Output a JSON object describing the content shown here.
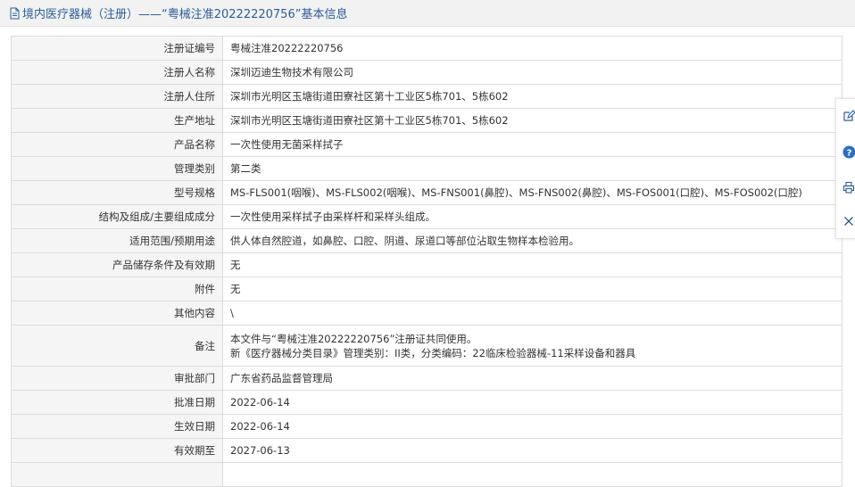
{
  "header": {
    "title": "境内医疗器械（注册）——“粤械注准20222220756”基本信息",
    "icon": "document-icon"
  },
  "rows": [
    {
      "label": "注册证编号",
      "value": [
        "粤械注准20222220756"
      ]
    },
    {
      "label": "注册人名称",
      "value": [
        "深圳迈迪生物技术有限公司"
      ]
    },
    {
      "label": "注册人住所",
      "value": [
        "深圳市光明区玉塘街道田寮社区第十工业区5栋701、5栋602"
      ]
    },
    {
      "label": "生产地址",
      "value": [
        "深圳市光明区玉塘街道田寮社区第十工业区5栋701、5栋602"
      ]
    },
    {
      "label": "产品名称",
      "value": [
        "一次性使用无菌采样拭子"
      ]
    },
    {
      "label": "管理类别",
      "value": [
        "第二类"
      ]
    },
    {
      "label": "型号规格",
      "value": [
        "MS-FLS001(咽喉)、MS-FLS002(咽喉)、MS-FNS001(鼻腔)、MS-FNS002(鼻腔)、MS-FOS001(口腔)、MS-FOS002(口腔)"
      ]
    },
    {
      "label": "结构及组成/主要组成成分",
      "value": [
        "一次性使用采样拭子由采样杆和采样头组成。"
      ]
    },
    {
      "label": "适用范围/预期用途",
      "value": [
        "供人体自然腔道，如鼻腔、口腔、阴道、尿道口等部位沾取生物样本检验用。"
      ]
    },
    {
      "label": "产品储存条件及有效期",
      "value": [
        "无"
      ]
    },
    {
      "label": "附件",
      "value": [
        "无"
      ]
    },
    {
      "label": "其他内容",
      "value": [
        "\\"
      ]
    },
    {
      "label": "备注",
      "value": [
        "本文件与“粤械注准20222220756”注册证共同使用。",
        "新《医疗器械分类目录》管理类别：II类，分类编码：22临床检验器械-11采样设备和器具"
      ]
    },
    {
      "label": "审批部门",
      "value": [
        "广东省药品监督管理局"
      ]
    },
    {
      "label": "批准日期",
      "value": [
        "2022-06-14"
      ]
    },
    {
      "label": "生效日期",
      "value": [
        "2022-06-14"
      ]
    },
    {
      "label": "有效期至",
      "value": [
        "2027-06-13"
      ]
    },
    {
      "label": "",
      "value": [
        ""
      ]
    }
  ],
  "side_tools": [
    {
      "icon": "edit-icon",
      "color": "#2c5d99"
    },
    {
      "icon": "help-icon",
      "color": "#2c6fc0"
    },
    {
      "icon": "print-icon",
      "color": "#2c5d99"
    },
    {
      "icon": "close-icon",
      "color": "#2c5d99"
    }
  ],
  "colors": {
    "title": "#2c5d99",
    "label_bg": "#f5f5f5",
    "border": "#dcdcdc",
    "header_bg": "#f2f2f2"
  }
}
